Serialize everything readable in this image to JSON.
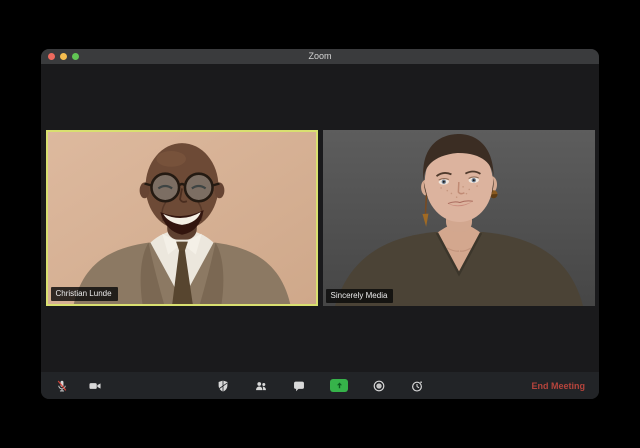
{
  "window": {
    "title": "Zoom",
    "traffic_lights": {
      "close": "#ed6a5e",
      "minimize": "#f5bd4f",
      "maximize": "#61c554"
    }
  },
  "participants": [
    {
      "name": "Christian Lunde",
      "active_speaker": true
    },
    {
      "name": "Sincerely Media",
      "active_speaker": false
    }
  ],
  "toolbar": {
    "left_icons": [
      "microphone-muted-icon",
      "video-camera-icon"
    ],
    "center_icons": [
      "security-shield-icon",
      "participants-icon",
      "chat-bubble-icon",
      "share-screen-arrow-icon",
      "record-icon",
      "clock-reactions-icon"
    ],
    "end_meeting_label": "End Meeting"
  },
  "colors": {
    "active_speaker_border": "#d9e070",
    "share_screen_green": "#36b34a",
    "end_meeting_red": "#b5443c",
    "titlebar": "#3a3b3d",
    "toolbar_bg": "#222427",
    "content_bg": "#1a1a1c"
  }
}
